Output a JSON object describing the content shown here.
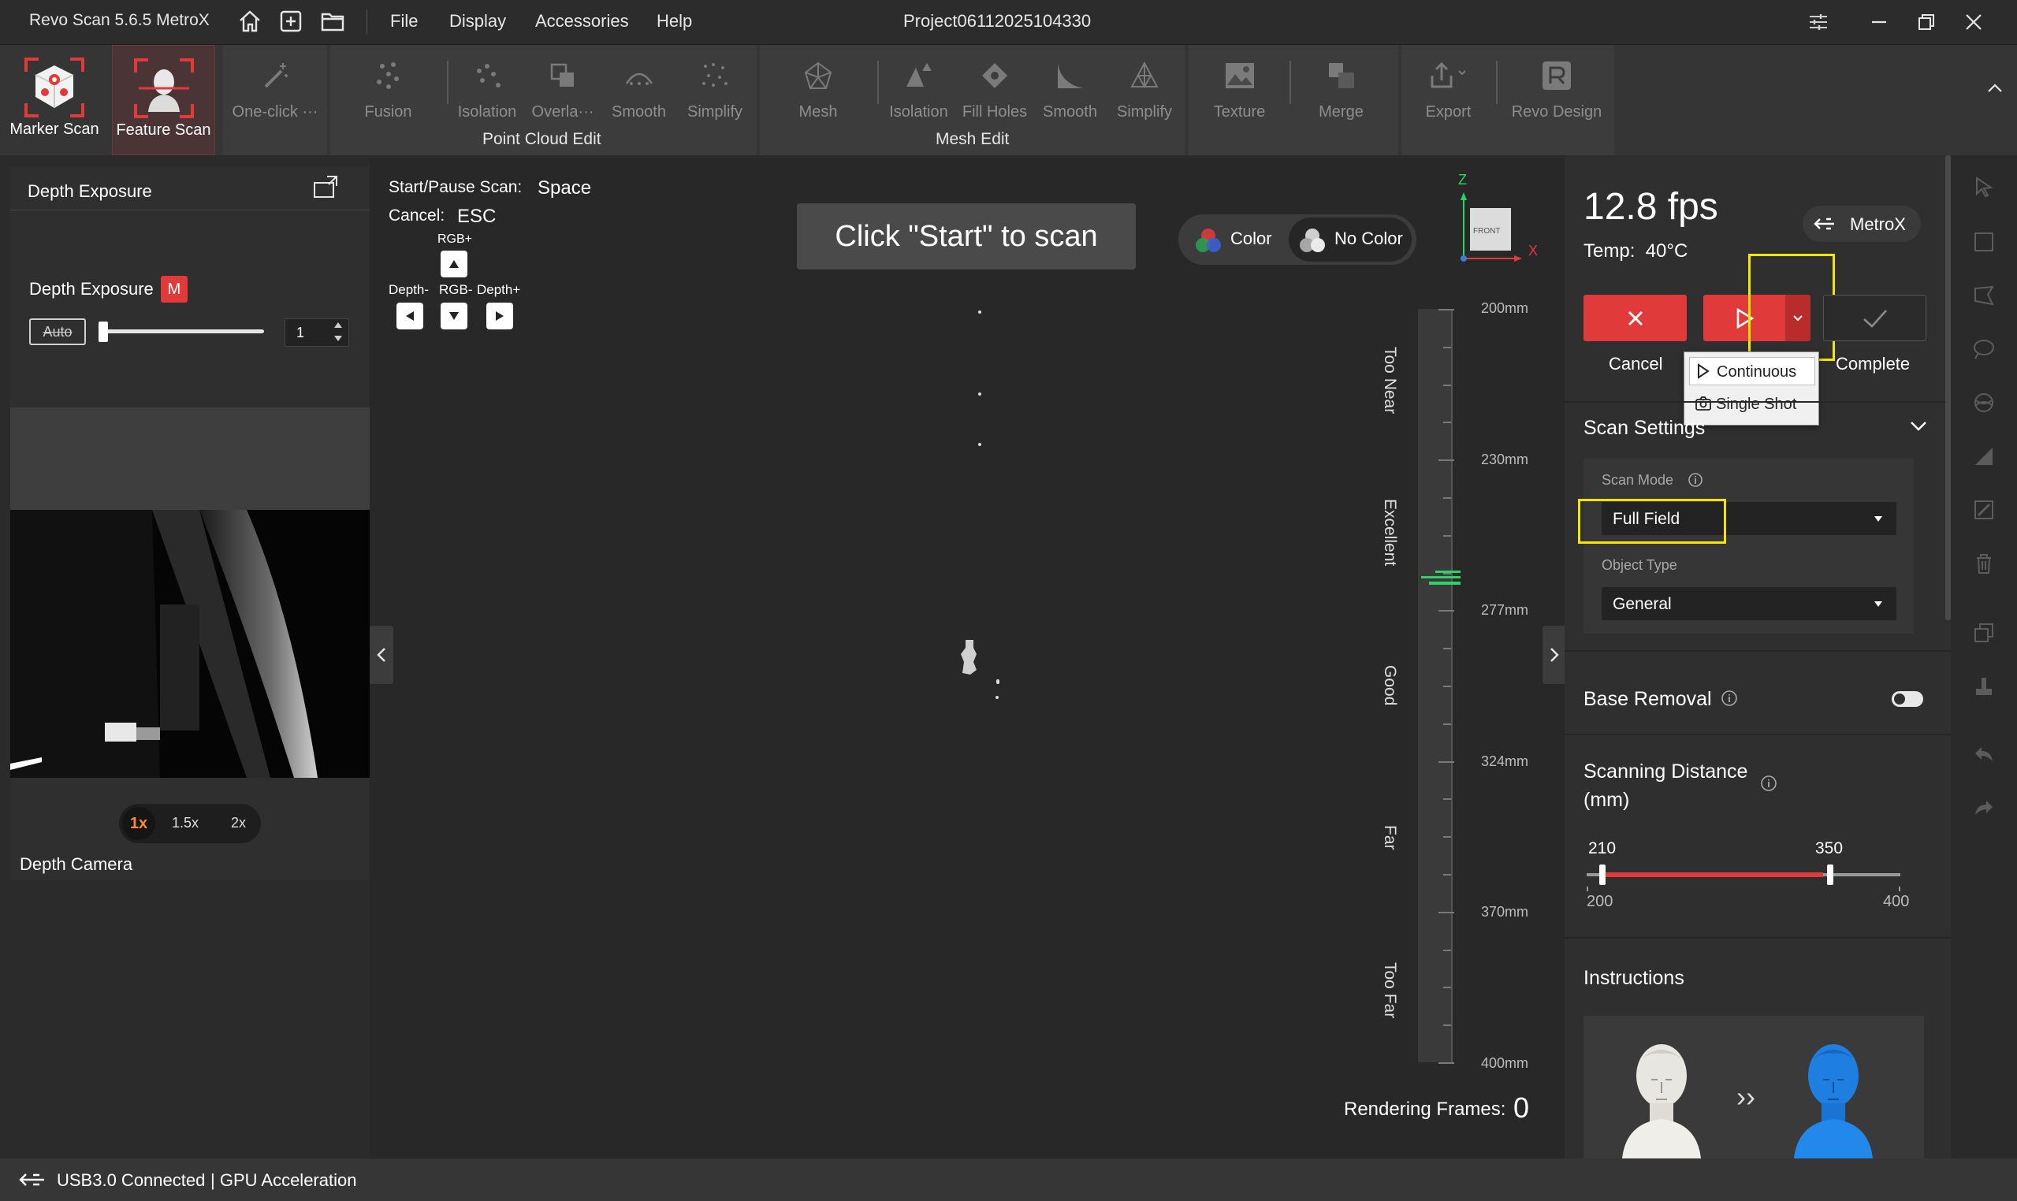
{
  "app": {
    "title": "Revo Scan 5.6.5 MetroX",
    "project": "Project06112025104330"
  },
  "menu": [
    "File",
    "Display",
    "Accessories",
    "Help"
  ],
  "toolbar": {
    "marker_scan": "Marker Scan",
    "feature_scan": "Feature Scan",
    "one_click": "One-click ···",
    "pc": {
      "fusion": "Fusion",
      "isolation": "Isolation",
      "overlap": "Overla···",
      "smooth": "Smooth",
      "simplify": "Simplify",
      "group": "Point Cloud Edit"
    },
    "mesh": {
      "mesh": "Mesh",
      "isolation": "Isolation",
      "fill_holes": "Fill Holes",
      "smooth": "Smooth",
      "simplify": "Simplify",
      "group": "Mesh Edit"
    },
    "texture": "Texture",
    "merge": "Merge",
    "export": "Export",
    "revo_design": "Revo Design"
  },
  "left": {
    "header": "Depth Exposure",
    "exposure_label": "Depth Exposure",
    "mode_badge": "M",
    "auto": "Auto",
    "exposure_value": "1",
    "zoom": [
      "1x",
      "1.5x",
      "2x"
    ],
    "camera_label": "Depth Camera"
  },
  "viewport": {
    "shortcut1_label": "Start/Pause Scan:",
    "shortcut1_key": "Space",
    "shortcut2_label": "Cancel:",
    "shortcut2_key": "ESC",
    "rgb_plus": "RGB+",
    "depth_minus": "Depth-",
    "rgb_minus": "RGB-",
    "depth_plus": "Depth+",
    "start_hint": "Click \"Start\" to scan",
    "color": "Color",
    "no_color": "No Color",
    "axis": {
      "z": "Z",
      "x": "X",
      "front": "FRONT"
    },
    "distance_ticks": [
      "200mm",
      "230mm",
      "277mm",
      "324mm",
      "370mm",
      "400mm"
    ],
    "zones": [
      "Too Near",
      "Excellent",
      "Good",
      "Far",
      "Too Far"
    ],
    "rendering_label": "Rendering Frames:",
    "rendering_value": "0"
  },
  "right": {
    "fps": "12.8 fps",
    "temp": "Temp:  40°C",
    "device": "MetroX",
    "cancel": "Cancel",
    "complete": "Complete",
    "dropdown": [
      "Continuous",
      "Single Shot"
    ],
    "scan_settings": "Scan Settings",
    "scan_mode_label": "Scan Mode",
    "scan_mode_value": "Full Field",
    "object_type_label": "Object Type",
    "object_type_value": "General",
    "base_removal": "Base Removal",
    "scanning_distance": "Scanning Distance\n(mm)",
    "range_low": "210",
    "range_high": "350",
    "range_min": "200",
    "range_max": "400",
    "instructions": "Instructions",
    "arrow": "››"
  },
  "status": {
    "usb": "USB3.0 Connected",
    "gpu": "| GPU Acceleration"
  },
  "colors": {
    "accent_red": "#e03a3a",
    "highlight": "#f5e600",
    "good_green": "#2fd16a"
  }
}
